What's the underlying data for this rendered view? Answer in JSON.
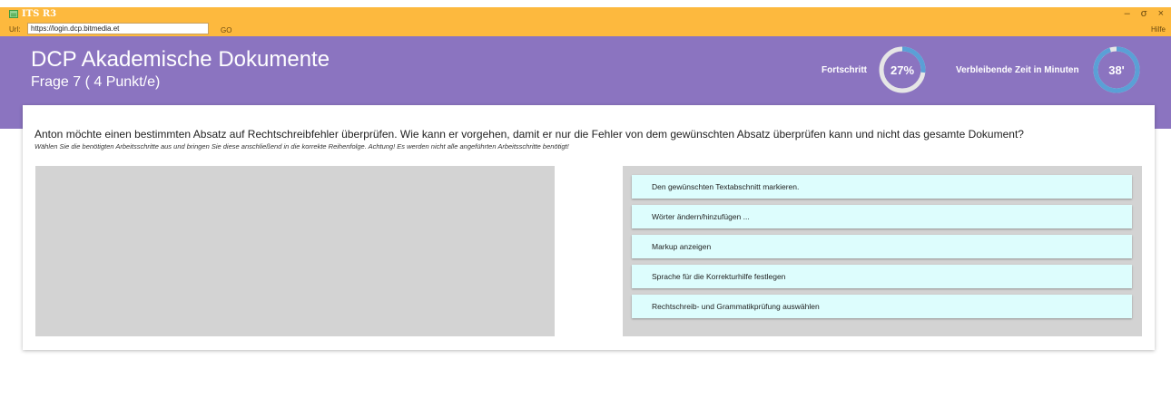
{
  "window": {
    "title": "ITS R3",
    "controls": {
      "minimize": "–",
      "restore": "σ",
      "close": "×"
    }
  },
  "urlbar": {
    "label": "Url:",
    "url": "https://login.dcp.bitmedia.et",
    "go": "GO",
    "help": "Hilfe"
  },
  "header": {
    "course_title": "DCP Akademische Dokumente",
    "question_label": "Frage 7 ( 4 Punkt/e)",
    "progress_label": "Fortschritt",
    "progress_value": "27%",
    "progress_fraction": 0.27,
    "time_label": "Verbleibende Zeit in Minuten",
    "time_value": "38'",
    "time_fraction": 0.95,
    "ring_color": "#5aa0d6",
    "ring_track_color": "#e6e6e6"
  },
  "question": {
    "text": "Anton möchte einen bestimmten Absatz auf Rechtschreibfehler überprüfen. Wie kann er vorgehen, damit er nur die Fehler von dem gewünschten Absatz überprüfen kann und nicht das gesamte Dokument?",
    "instruction": "Wählen Sie die benötigten Arbeitsschritte aus und bringen Sie diese anschließend in die korrekte Reihenfolge. Achtung! Es werden nicht alle angeführten Arbeitsschritte benötigt!"
  },
  "options": [
    {
      "label": "Den gewünschten Textabschnitt markieren."
    },
    {
      "label": "Wörter ändern/hinzufügen ..."
    },
    {
      "label": "Markup anzeigen"
    },
    {
      "label": "Sprache für die Korrekturhilfe festlegen"
    },
    {
      "label": "Rechtschreib- und Grammatikprüfung auswählen"
    }
  ],
  "colors": {
    "titlebar": "#fdb93e",
    "header": "#8b74c0",
    "option_bg": "#ddfdfd",
    "zone_bg": "#d3d3d3"
  }
}
